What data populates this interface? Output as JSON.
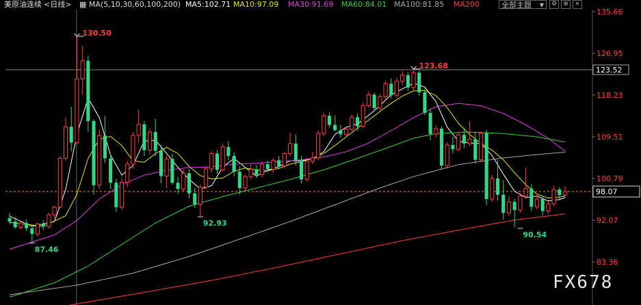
{
  "header": {
    "symbol": "美原油连续",
    "period": "<日线>",
    "ma_params": "MA(5,10,30,60,100,200)",
    "ma5": "MA5:102.71",
    "ma10": "MA10:97.09",
    "ma30": "MA30:91.69",
    "ma60": "MA60:84.01",
    "ma100": "MA100:81.85",
    "ma200": "MA200",
    "theme_label": "全部主题",
    "colors": {
      "ma5": "#ffffff",
      "ma10": "#e6e600",
      "ma30": "#e040e0",
      "ma60": "#39d139",
      "ma100": "#a8a8a8",
      "ma200": "#ff3c3c",
      "up": "#ff4242",
      "down": "#35d58a"
    }
  },
  "watermark": "FX678",
  "chart_data": {
    "type": "candlestick",
    "y_ticks": [
      "135.66",
      "126.95",
      "118.23",
      "109.51",
      "100.79",
      "92.07",
      "83.36"
    ],
    "ylim": [
      80.0,
      137.0
    ],
    "crosshair_price": "123.52",
    "current_price": "98.07",
    "annotations": [
      {
        "text": "130.50",
        "index": 12,
        "value": 130.5,
        "type": "high"
      },
      {
        "text": "87.46",
        "index": 4,
        "value": 87.46,
        "type": "low"
      },
      {
        "text": "92.93",
        "index": 34,
        "value": 92.93,
        "type": "low"
      },
      {
        "text": "123.68",
        "index": 72,
        "value": 123.68,
        "type": "high"
      },
      {
        "text": "90.54",
        "index": 91,
        "value": 90.54,
        "type": "low"
      }
    ],
    "candles": [
      [
        92.5,
        93.6,
        91.2,
        91.8
      ],
      [
        91.8,
        92.8,
        90.3,
        90.6
      ],
      [
        90.6,
        91.8,
        90.2,
        91.5
      ],
      [
        91.5,
        92.2,
        89.8,
        90.4
      ],
      [
        90.4,
        91.0,
        87.5,
        89.2
      ],
      [
        89.2,
        91.6,
        88.6,
        91.3
      ],
      [
        91.3,
        92.1,
        90.0,
        90.7
      ],
      [
        90.7,
        93.6,
        90.3,
        93.2
      ],
      [
        93.2,
        95.1,
        92.5,
        94.8
      ],
      [
        94.8,
        105.5,
        94.6,
        105.0
      ],
      [
        105.0,
        113.5,
        104.5,
        111.6
      ],
      [
        111.6,
        115.8,
        106.5,
        108.3
      ],
      [
        108.3,
        130.5,
        108.0,
        121.6
      ],
      [
        121.6,
        128.5,
        118.3,
        125.4
      ],
      [
        125.4,
        126.5,
        110.5,
        112.8
      ],
      [
        112.8,
        113.2,
        97.4,
        99.4
      ],
      [
        99.4,
        111.0,
        98.6,
        109.8
      ],
      [
        109.8,
        113.9,
        104.0,
        105.0
      ],
      [
        105.0,
        106.0,
        98.6,
        99.9
      ],
      [
        99.9,
        100.7,
        93.8,
        94.8
      ],
      [
        94.8,
        101.0,
        94.2,
        100.0
      ],
      [
        100.0,
        104.5,
        99.0,
        103.8
      ],
      [
        103.8,
        110.5,
        102.9,
        109.8
      ],
      [
        109.8,
        115.1,
        108.2,
        112.1
      ],
      [
        112.1,
        112.8,
        105.5,
        106.7
      ],
      [
        106.7,
        111.3,
        105.8,
        110.5
      ],
      [
        110.5,
        113.3,
        105.5,
        106.6
      ],
      [
        106.6,
        107.8,
        99.8,
        101.3
      ],
      [
        101.3,
        105.6,
        98.8,
        104.9
      ],
      [
        104.9,
        106.0,
        99.5,
        99.9
      ],
      [
        99.9,
        101.2,
        97.5,
        98.6
      ],
      [
        98.6,
        102.7,
        98.0,
        101.9
      ],
      [
        101.9,
        102.8,
        96.6,
        97.7
      ],
      [
        97.7,
        98.8,
        94.6,
        95.4
      ],
      [
        95.4,
        99.6,
        92.9,
        99.0
      ],
      [
        99.0,
        103.4,
        98.5,
        102.8
      ],
      [
        102.8,
        106.6,
        102.1,
        106.0
      ],
      [
        106.0,
        106.8,
        101.8,
        102.6
      ],
      [
        102.6,
        108.0,
        102.3,
        107.4
      ],
      [
        107.4,
        108.6,
        104.6,
        105.5
      ],
      [
        105.5,
        106.2,
        101.2,
        102.2
      ],
      [
        102.2,
        103.4,
        97.5,
        98.8
      ],
      [
        98.8,
        101.6,
        98.2,
        101.2
      ],
      [
        101.2,
        103.8,
        100.6,
        102.7
      ],
      [
        102.7,
        103.6,
        100.9,
        101.6
      ],
      [
        101.6,
        104.4,
        101.0,
        103.8
      ],
      [
        103.8,
        104.5,
        102.1,
        102.7
      ],
      [
        102.7,
        105.0,
        102.0,
        104.6
      ],
      [
        104.6,
        105.5,
        103.0,
        103.4
      ],
      [
        103.4,
        106.3,
        103.0,
        106.0
      ],
      [
        106.0,
        110.3,
        105.5,
        108.1
      ],
      [
        108.1,
        110.0,
        103.5,
        104.6
      ],
      [
        104.6,
        105.5,
        99.8,
        100.6
      ],
      [
        100.6,
        105.1,
        100.1,
        104.4
      ],
      [
        104.4,
        106.4,
        103.8,
        105.1
      ],
      [
        105.1,
        110.8,
        104.6,
        110.2
      ],
      [
        110.2,
        114.5,
        109.6,
        113.9
      ],
      [
        113.9,
        114.6,
        111.4,
        112.0
      ],
      [
        112.0,
        114.0,
        110.6,
        110.9
      ],
      [
        110.9,
        112.0,
        109.3,
        110.0
      ],
      [
        110.0,
        111.5,
        109.4,
        111.1
      ],
      [
        111.1,
        114.2,
        110.7,
        113.6
      ],
      [
        113.6,
        114.4,
        110.8,
        111.7
      ],
      [
        111.7,
        116.7,
        111.3,
        116.0
      ],
      [
        116.0,
        119.0,
        115.5,
        118.3
      ],
      [
        118.3,
        118.8,
        115.0,
        115.5
      ],
      [
        115.5,
        118.4,
        115.1,
        117.9
      ],
      [
        117.9,
        121.2,
        117.2,
        120.6
      ],
      [
        120.6,
        121.7,
        117.5,
        118.2
      ],
      [
        118.2,
        121.9,
        117.6,
        121.1
      ],
      [
        121.1,
        123.2,
        120.3,
        122.4
      ],
      [
        122.4,
        123.0,
        119.1,
        119.8
      ],
      [
        119.8,
        123.68,
        119.3,
        122.9
      ],
      [
        122.9,
        123.3,
        118.1,
        118.8
      ],
      [
        118.8,
        119.6,
        114.0,
        114.5
      ],
      [
        114.5,
        115.4,
        108.8,
        110.1
      ],
      [
        110.1,
        111.9,
        109.4,
        111.2
      ],
      [
        111.2,
        111.7,
        102.6,
        103.5
      ],
      [
        103.5,
        108.4,
        102.9,
        107.8
      ],
      [
        107.8,
        109.5,
        106.0,
        106.9
      ],
      [
        106.9,
        110.6,
        106.5,
        109.9
      ],
      [
        109.9,
        111.4,
        107.2,
        108.1
      ],
      [
        108.1,
        112.8,
        107.6,
        109.0
      ],
      [
        109.0,
        110.6,
        103.9,
        104.7
      ],
      [
        104.7,
        110.6,
        104.2,
        110.3
      ],
      [
        110.3,
        111.0,
        95.2,
        96.5
      ],
      [
        96.5,
        101.5,
        95.9,
        100.8
      ],
      [
        100.8,
        104.6,
        96.2,
        97.4
      ],
      [
        97.4,
        100.5,
        92.2,
        93.6
      ],
      [
        93.6,
        97.1,
        93.0,
        95.9
      ],
      [
        95.9,
        96.5,
        90.54,
        94.2
      ],
      [
        94.2,
        97.8,
        93.6,
        97.1
      ],
      [
        97.1,
        103.1,
        96.6,
        98.7
      ],
      [
        98.7,
        99.6,
        94.0,
        94.9
      ],
      [
        94.9,
        97.3,
        94.3,
        96.5
      ],
      [
        96.5,
        97.2,
        93.1,
        94.0
      ],
      [
        94.0,
        96.1,
        93.4,
        95.5
      ],
      [
        95.5,
        99.3,
        95.0,
        98.5
      ],
      [
        98.5,
        99.0,
        96.4,
        97.3
      ],
      [
        97.3,
        99.2,
        96.8,
        98.07
      ]
    ],
    "ma_series": {
      "ma5": [
        [
          0,
          92.9
        ],
        [
          4,
          90.8
        ],
        [
          8,
          91.8
        ],
        [
          10,
          98.5
        ],
        [
          12,
          110.0
        ],
        [
          14,
          117.6
        ],
        [
          16,
          113.5
        ],
        [
          18,
          105.7
        ],
        [
          20,
          101.5
        ],
        [
          22,
          103.5
        ],
        [
          24,
          108.6
        ],
        [
          26,
          108.8
        ],
        [
          28,
          106.0
        ],
        [
          30,
          103.1
        ],
        [
          32,
          100.6
        ],
        [
          34,
          98.6
        ],
        [
          36,
          99.3
        ],
        [
          38,
          103.2
        ],
        [
          40,
          105.0
        ],
        [
          42,
          103.1
        ],
        [
          44,
          101.3
        ],
        [
          46,
          102.5
        ],
        [
          48,
          103.3
        ],
        [
          50,
          104.5
        ],
        [
          52,
          104.5
        ],
        [
          54,
          104.9
        ],
        [
          56,
          106.4
        ],
        [
          58,
          110.0
        ],
        [
          60,
          111.5
        ],
        [
          62,
          112.2
        ],
        [
          64,
          114.0
        ],
        [
          66,
          116.0
        ],
        [
          68,
          118.3
        ],
        [
          70,
          119.5
        ],
        [
          72,
          120.7
        ],
        [
          74,
          119.9
        ],
        [
          76,
          116.8
        ],
        [
          78,
          111.5
        ],
        [
          80,
          108.6
        ],
        [
          82,
          108.2
        ],
        [
          84,
          108.1
        ],
        [
          86,
          105.6
        ],
        [
          88,
          101.7
        ],
        [
          90,
          98.1
        ],
        [
          92,
          96.8
        ],
        [
          94,
          97.1
        ],
        [
          96,
          96.1
        ],
        [
          98,
          96.4
        ],
        [
          99,
          96.8
        ]
      ],
      "ma10": [
        [
          0,
          91.6
        ],
        [
          6,
          90.8
        ],
        [
          10,
          93.0
        ],
        [
          12,
          97.5
        ],
        [
          14,
          105.0
        ],
        [
          16,
          109.0
        ],
        [
          18,
          109.6
        ],
        [
          20,
          107.7
        ],
        [
          22,
          104.5
        ],
        [
          24,
          104.2
        ],
        [
          26,
          106.0
        ],
        [
          28,
          107.3
        ],
        [
          30,
          106.0
        ],
        [
          32,
          103.3
        ],
        [
          34,
          101.4
        ],
        [
          36,
          100.7
        ],
        [
          38,
          100.9
        ],
        [
          40,
          102.3
        ],
        [
          42,
          103.0
        ],
        [
          44,
          102.6
        ],
        [
          46,
          102.4
        ],
        [
          48,
          102.9
        ],
        [
          50,
          103.8
        ],
        [
          52,
          104.3
        ],
        [
          54,
          105.0
        ],
        [
          56,
          106.0
        ],
        [
          58,
          107.7
        ],
        [
          60,
          109.5
        ],
        [
          62,
          111.3
        ],
        [
          64,
          113.0
        ],
        [
          66,
          114.8
        ],
        [
          68,
          116.5
        ],
        [
          70,
          118.0
        ],
        [
          72,
          119.1
        ],
        [
          74,
          119.2
        ],
        [
          76,
          118.1
        ],
        [
          78,
          115.6
        ],
        [
          80,
          112.3
        ],
        [
          82,
          110.0
        ],
        [
          84,
          108.1
        ],
        [
          86,
          106.7
        ],
        [
          88,
          104.7
        ],
        [
          90,
          102.0
        ],
        [
          92,
          99.5
        ],
        [
          94,
          97.5
        ],
        [
          96,
          96.7
        ],
        [
          98,
          96.9
        ],
        [
          99,
          97.1
        ]
      ],
      "ma30": [
        [
          0,
          86.0
        ],
        [
          8,
          89.0
        ],
        [
          12,
          92.0
        ],
        [
          16,
          96.5
        ],
        [
          20,
          99.5
        ],
        [
          24,
          101.5
        ],
        [
          28,
          102.5
        ],
        [
          32,
          103.1
        ],
        [
          36,
          103.2
        ],
        [
          40,
          103.8
        ],
        [
          44,
          104.0
        ],
        [
          48,
          104.3
        ],
        [
          52,
          104.7
        ],
        [
          56,
          105.3
        ],
        [
          60,
          106.4
        ],
        [
          64,
          108.2
        ],
        [
          68,
          110.8
        ],
        [
          72,
          113.5
        ],
        [
          76,
          115.8
        ],
        [
          80,
          116.5
        ],
        [
          84,
          116.0
        ],
        [
          88,
          114.4
        ],
        [
          92,
          112.0
        ],
        [
          96,
          109.2
        ],
        [
          99,
          106.5
        ]
      ],
      "ma60": [
        [
          0,
          76.0
        ],
        [
          8,
          79.0
        ],
        [
          14,
          82.5
        ],
        [
          20,
          87.0
        ],
        [
          26,
          91.5
        ],
        [
          32,
          95.0
        ],
        [
          38,
          97.0
        ],
        [
          44,
          98.8
        ],
        [
          50,
          100.6
        ],
        [
          56,
          102.6
        ],
        [
          62,
          105.0
        ],
        [
          68,
          107.5
        ],
        [
          72,
          109.2
        ],
        [
          76,
          110.2
        ],
        [
          82,
          110.5
        ],
        [
          88,
          110.2
        ],
        [
          94,
          109.5
        ],
        [
          99,
          108.4
        ]
      ],
      "ma100": [
        [
          0,
          76.5
        ],
        [
          12,
          78.5
        ],
        [
          22,
          81.0
        ],
        [
          32,
          84.5
        ],
        [
          42,
          88.5
        ],
        [
          50,
          91.8
        ],
        [
          58,
          95.3
        ],
        [
          66,
          98.8
        ],
        [
          72,
          101.2
        ],
        [
          80,
          103.7
        ],
        [
          88,
          105.1
        ],
        [
          94,
          105.8
        ],
        [
          99,
          106.3
        ]
      ],
      "ma200": [
        [
          0,
          72.0
        ],
        [
          12,
          74.6
        ],
        [
          24,
          77.0
        ],
        [
          36,
          79.5
        ],
        [
          48,
          82.3
        ],
        [
          60,
          85.3
        ],
        [
          70,
          87.8
        ],
        [
          80,
          90.0
        ],
        [
          90,
          92.1
        ],
        [
          99,
          93.4
        ]
      ]
    }
  }
}
